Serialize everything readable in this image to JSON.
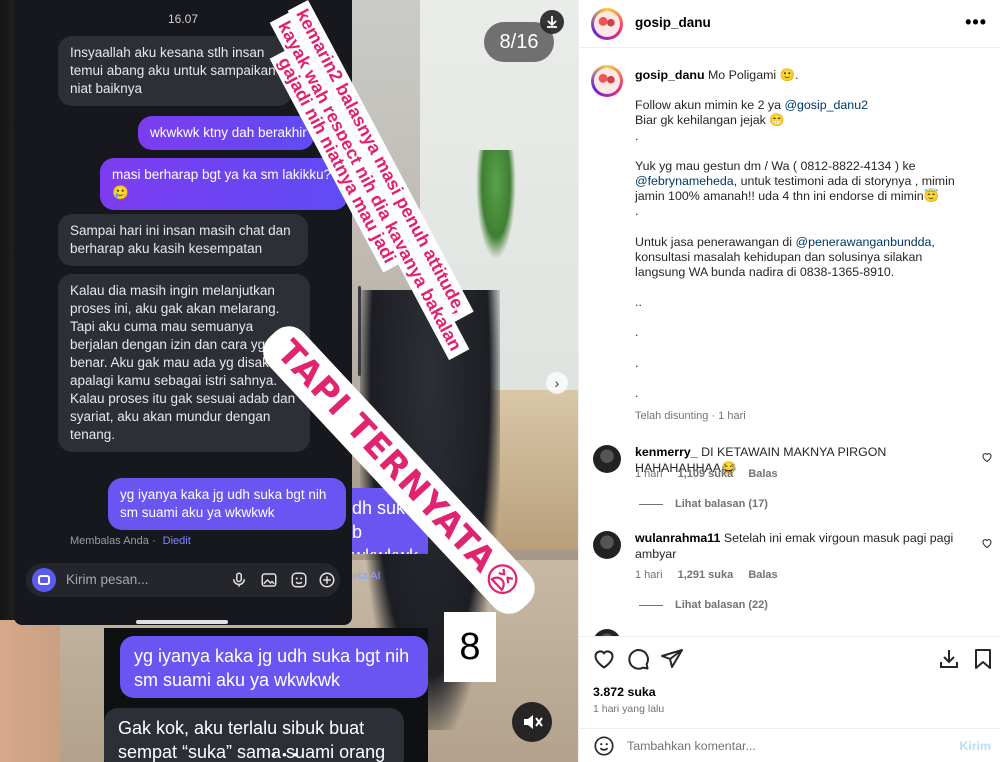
{
  "media": {
    "counter": "8/16",
    "page_number": "8",
    "phone": {
      "time": "16.07",
      "messages": [
        {
          "dir": "in",
          "text": "Insyaallah aku kesana stlh insan temui abang aku untuk sampaikan niat baiknya"
        },
        {
          "dir": "out",
          "text": "wkwkwk ktny dah berakhir"
        },
        {
          "dir": "out",
          "text": "masi berharap bgt ya ka sm lakikku? 🥲"
        },
        {
          "dir": "in",
          "text": "Sampai hari ini insan masih chat dan berharap aku kasih kesempatan"
        },
        {
          "dir": "in",
          "text": "Kalau dia masih ingin melanjutkan proses ini, aku gak akan melarang. Tapi aku cuma mau semuanya berjalan dengan izin dan cara yg benar. Aku gak mau ada yg disakiti, apalagi kamu sebagai istri sahnya. Kalau proses itu gak sesuai adab dan syariat, aku akan mundur dengan tenang."
        },
        {
          "dir": "out",
          "text": "yg iyanya kaka jg udh suka bgt nih sm suami aku ya wkwkwk"
        }
      ],
      "replied_label": "Membalas Anda",
      "edited_label": "Diedit",
      "composer_placeholder": "Kirim pesan..."
    },
    "bg_chat": {
      "right_bubble": "dh suka b wkwkwk",
      "meta_ai": "leta AI",
      "out_text": "yg iyanya kaka jg udh suka bgt nih sm suami aku ya wkwkwk",
      "in_text": "Gak kok, aku terlalu sibuk buat sempat “suka” sama suami orang"
    },
    "overlay": {
      "line1": "kemarin2 balasnya masi penuh attitude,",
      "line2": "kayak wah respect nih dia kayanya bakalan",
      "line3": "gajadi nih niatnya mau jadi",
      "tapi": "TAPI TERNYATA😫"
    }
  },
  "post": {
    "username": "gosip_danu",
    "caption": {
      "title": "Mo Poligami 🙂.",
      "follow_prefix": "Follow akun mimin ke 2 ya ",
      "follow_link": "@gosip_danu2",
      "follow_line2": "Biar gk kehilangan jejak 😁",
      "dot1": ".",
      "gestun_prefix": "Yuk yg mau gestun dm / Wa ( 0812-8822-4134 ) ke ",
      "gestun_link": "@febrynameheda",
      "gestun_suffix": ", untuk testimoni ada di storynya , mimin jamin 100% amanah!! uda 4 thn ini endorse di mimin😇",
      "dot2": ".",
      "jasa_prefix": "Untuk jasa penerawangan di ",
      "jasa_link": "@penerawanganbundda",
      "jasa_suffix": ", konsultasi masalah kehidupan dan solusinya silakan langsung WA bunda nadira di 0838-1365-8910.",
      "dots": [
        "..",
        ".",
        ".",
        "."
      ],
      "edited_time": "Telah disunting · 1 hari"
    },
    "comments": [
      {
        "user": "kenmerry_",
        "text": "DI KETAWAIN MAKNYA PIRGON HAHAHAHHAA😂",
        "time": "1 hari",
        "likes": "1,109 suka",
        "reply": "Balas",
        "view_replies": "Lihat balasan (17)"
      },
      {
        "user": "wulanrahma11",
        "text": "Setelah ini emak virgoun masuk pagi pagi ambyar",
        "time": "1 hari",
        "likes": "1,291 suka",
        "reply": "Balas",
        "view_replies": "Lihat balasan (22)"
      }
    ],
    "likes": "3.872 suka",
    "time_ago": "1 hari yang lalu",
    "add_comment_placeholder": "Tambahkan komentar...",
    "post_label": "Kirim"
  }
}
